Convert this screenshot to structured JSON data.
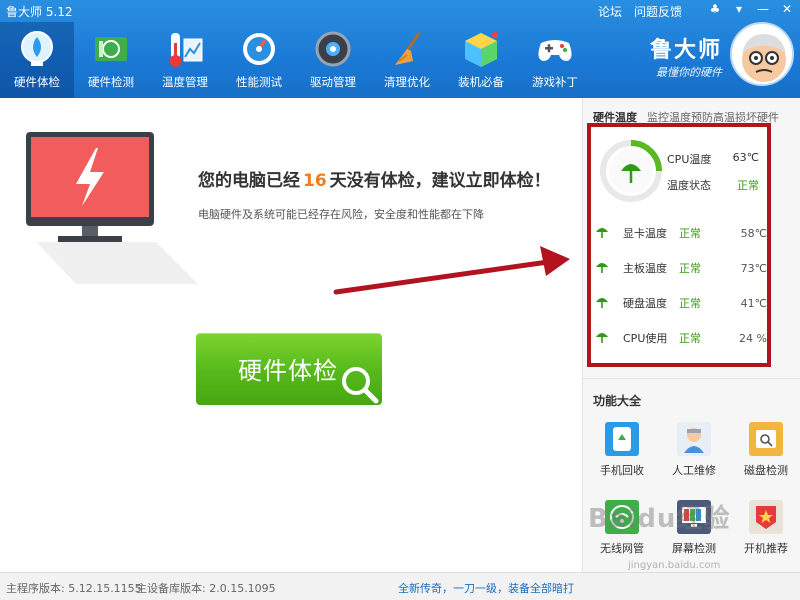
{
  "window": {
    "title": "鲁大师 5.12",
    "links": [
      "论坛",
      "问题反馈"
    ]
  },
  "nav": [
    {
      "label": "硬件体检",
      "icon": "monitor-check-icon",
      "active": true
    },
    {
      "label": "硬件检测",
      "icon": "circuit-board-icon"
    },
    {
      "label": "温度管理",
      "icon": "thermometer-icon"
    },
    {
      "label": "性能测试",
      "icon": "speedometer-icon"
    },
    {
      "label": "驱动管理",
      "icon": "driver-gear-icon"
    },
    {
      "label": "清理优化",
      "icon": "broom-icon"
    },
    {
      "label": "装机必备",
      "icon": "package-box-icon"
    },
    {
      "label": "游戏补丁",
      "icon": "gamepad-icon"
    }
  ],
  "brand": {
    "name": "鲁大师",
    "slogan": "最懂你的硬件"
  },
  "main": {
    "alert_prefix": "您的电脑已经",
    "days": "16",
    "alert_suffix": "天没有体检，建议立即体检！",
    "subtitle": "电脑硬件及系统可能已经存在风险，安全度和性能都在下降",
    "check_button": "硬件体检"
  },
  "hardware_temp": {
    "title": "硬件温度",
    "subtitle": "监控温度预防高温损坏硬件",
    "cpu_label": "CPU温度",
    "cpu_value": "63℃",
    "status_label": "温度状态",
    "status_value": "正常",
    "rows": [
      {
        "name": "显卡温度",
        "status": "正常",
        "value": "58℃"
      },
      {
        "name": "主板温度",
        "status": "正常",
        "value": "73℃"
      },
      {
        "name": "硬盘温度",
        "status": "正常",
        "value": "41℃"
      },
      {
        "name": "CPU使用",
        "status": "正常",
        "value": "24 %"
      }
    ],
    "colors": {
      "ok": "#3a9b12",
      "highlight_box": "#b3121f"
    }
  },
  "functions": {
    "title": "功能大全",
    "items": [
      {
        "label": "手机回收",
        "icon": "phone-recycle-icon"
      },
      {
        "label": "人工维修",
        "icon": "technician-icon"
      },
      {
        "label": "磁盘检测",
        "icon": "disk-check-icon"
      },
      {
        "label": "无线网管",
        "icon": "wifi-icon"
      },
      {
        "label": "屏幕检测",
        "icon": "screen-test-icon"
      },
      {
        "label": "开机推荐",
        "icon": "startup-star-icon"
      }
    ]
  },
  "status": {
    "main_version": "主程序版本: 5.12.15.1155",
    "db_version": "主设备库版本: 2.0.15.1095",
    "promo": "全新传奇，一刀一级，装备全部暗打"
  },
  "watermark": {
    "text": "Baidu经验",
    "url": "jingyan.baidu.com"
  }
}
